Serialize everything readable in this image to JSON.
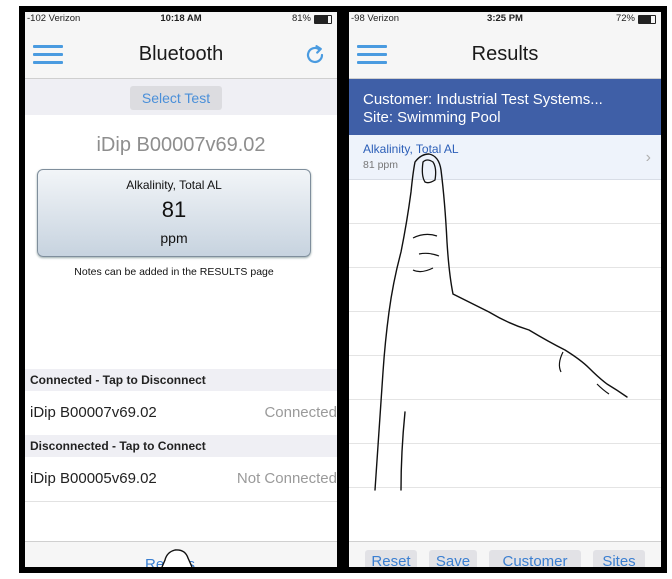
{
  "left_phone": {
    "status": {
      "carrier": "-102 Verizon",
      "time": "10:18 AM",
      "battery": "81%",
      "battery_level": 0.81
    },
    "nav": {
      "title": "Bluetooth",
      "menu_icon": "hamburger-menu-icon",
      "refresh_icon": "refresh-icon"
    },
    "select_test_label": "Select Test",
    "device_title": "iDip B00007v69.02",
    "result": {
      "parameter": "Alkalinity, Total AL",
      "value": "81",
      "unit": "ppm"
    },
    "notes": "Notes can be added in the RESULTS page",
    "connected_section": {
      "header": "Connected - Tap to Disconnect",
      "devices": [
        {
          "name": "iDip  B00007v69.02",
          "state": "Connected"
        }
      ]
    },
    "disconnected_section": {
      "header": "Disconnected - Tap to Connect",
      "devices": [
        {
          "name": "iDip  B00005v69.02",
          "state": "Not Connected"
        }
      ]
    },
    "bottom": {
      "results_label": "Results"
    }
  },
  "right_phone": {
    "status": {
      "carrier": "-98 Verizon",
      "time": "3:25 PM",
      "battery": "72%",
      "battery_level": 0.72
    },
    "nav": {
      "title": "Results",
      "menu_icon": "hamburger-menu-icon"
    },
    "customer": {
      "customer_line": "Customer: Industrial Test Systems...",
      "site_line": "Site: Swimming Pool"
    },
    "results": [
      {
        "parameter": "Alkalinity, Total AL",
        "value": "81 ppm"
      }
    ],
    "toolbar": {
      "reset": "Reset",
      "save": "Save",
      "customer": "Customer",
      "sites": "Sites"
    }
  },
  "colors": {
    "accent": "#3b7fd1",
    "customer_band": "#3f5fa7",
    "menu_icon": "#4a9be0"
  }
}
